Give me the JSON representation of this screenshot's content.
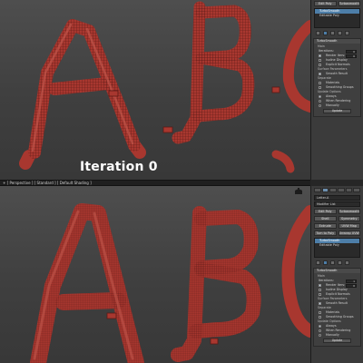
{
  "iteration_label": "Iteration 0",
  "viewport_title": "+ [ Perspective ] [ Standard ] [ Default Shading ]",
  "panel_top": {
    "top_buttons": [
      "Edit Poly",
      "Turbosmooth"
    ],
    "modifier_stack": [
      {
        "label": "TurboSmooth",
        "selected": true
      },
      {
        "label": "Editable Poly",
        "selected": false
      }
    ],
    "rollout_title": "TurboSmooth",
    "main_label": "Main",
    "iterations_label": "Iterations:",
    "iterations_value": "0",
    "render_iters_label": "Render Iters:",
    "render_iters_value": "0",
    "isoline_label": "Isoline Display",
    "explicit_normals_label": "Explicit Normals",
    "surface_params_label": "Surface Parameters",
    "smooth_result_label": "Smooth Result",
    "separate_label": "Separate",
    "materials_label": "Materials",
    "smoothing_groups_label": "Smoothing Groups",
    "update_options_label": "Update Options",
    "always_label": "Always",
    "when_rendering_label": "When Rendering",
    "manually_label": "Manually",
    "update_button": "Update"
  },
  "panel_bot": {
    "object_name": "Letter-A",
    "modifier_list": "Modifier List",
    "grid_buttons": [
      "Edit Poly",
      "Turbosmooth",
      "Shell",
      "Symmetry",
      "Extrude",
      "UVW Map",
      "Turn to Poly",
      "Unwrap UVW"
    ],
    "modifier_stack": [
      {
        "label": "TurboSmooth",
        "selected": true
      },
      {
        "label": "Editable Poly",
        "selected": false
      }
    ],
    "rollout_title": "TurboSmooth",
    "main_label": "Main",
    "iterations_label": "Iterations:",
    "iterations_value": "1",
    "render_iters_label": "Render Iters:",
    "render_iters_value": "0",
    "isoline_label": "Isoline Display",
    "explicit_normals_label": "Explicit Normals",
    "surface_params_label": "Surface Parameters",
    "smooth_result_label": "Smooth Result",
    "separate_label": "Separate",
    "materials_label": "Materials",
    "smoothing_groups_label": "Smoothing Groups",
    "update_options_label": "Update Options",
    "always_label": "Always",
    "when_rendering_label": "When Rendering",
    "manually_label": "Manually",
    "update_button": "Update"
  },
  "colors": {
    "pipe_fill": "#a8372f",
    "pipe_highlight": "#c65a4f",
    "pipe_wire": "#5a1a16",
    "selection_blue": "#4d7ea8",
    "viewport_bg": "#474747",
    "panel_bg": "#3b3b3b"
  }
}
